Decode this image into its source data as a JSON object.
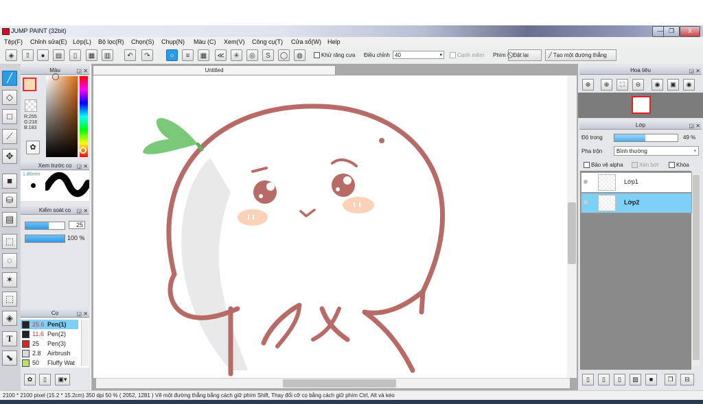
{
  "window": {
    "title": "JUMP PAINT (32bit)",
    "minimize": "—",
    "maximize": "❐",
    "close": "X"
  },
  "menu": [
    "Tệp(F)",
    "Chỉnh sửa(E)",
    "Lớp(L)",
    "Bộ lọc(R)",
    "Chọn(S)",
    "Chụp(N)",
    "Màu (C)",
    "Xem(V)",
    "Công cụ(T)",
    "Cửa sổ(W)",
    "Help"
  ],
  "toolbar": {
    "antialias_label": "Khử răng cưa",
    "adjust_label": "Điều chỉnh",
    "adjust_value": "40",
    "smooth_edge_label": "Cạnh mềm",
    "key_label": "Phím",
    "reset_label": "Đặt lại",
    "straight_line_label": "Tạo một đường thẳng"
  },
  "panels": {
    "color": {
      "title": "Màu",
      "r": "R:255",
      "g": "G:218",
      "b": "B:183",
      "fg_color": "#ffdab7"
    },
    "brush_preview": {
      "title": "Xem trước cọ",
      "size": "1.86mm"
    },
    "brush_control": {
      "title": "Kiểm soát cọ",
      "size_value": "25",
      "opacity_value": "100 %",
      "size_fraction": 0.6,
      "opacity_fraction": 1.0
    },
    "brushes": {
      "title": "Cọ",
      "items": [
        {
          "size": "25.6",
          "name": "Pen(1)",
          "color": "#222222",
          "selected": true
        },
        {
          "size": "11.6",
          "name": "Pen(2)",
          "color": "#222222",
          "selected": false
        },
        {
          "size": "25",
          "name": "Pen(3)",
          "color": "#dd2222",
          "selected": false
        },
        {
          "size": "2.8",
          "name": "Airbrush",
          "color": "#d8d8d8",
          "selected": false
        },
        {
          "size": "50",
          "name": "Fluffy Wat",
          "color": "#b9e06a",
          "selected": false
        }
      ]
    }
  },
  "document": {
    "tab_title": "Untitled"
  },
  "navigator": {
    "title": "Hoa tiêu"
  },
  "layers": {
    "title": "Lớp",
    "opacity_label": "Độ trong",
    "opacity_value": "49 %",
    "opacity_fraction": 0.49,
    "blend_label": "Pha trộn",
    "blend_value": "Bình thường",
    "protect_alpha_label": "Bảo vệ alpha",
    "draft_label": "Xén bớt",
    "lock_label": "Khóa",
    "items": [
      {
        "name": "Lớp1",
        "selected": false
      },
      {
        "name": "Lớp2",
        "selected": true
      }
    ]
  },
  "status": {
    "text": "2100 * 2100 pixel  (15.2 * 15.2cm)  350 dpi  50 %  ( 2052, 1281 )  Vẽ một đường thẳng bằng cách giữ phím Shift, Thay đổi cỡ cọ bằng cách giữ phím Ctrl, Alt và kéo"
  },
  "colors": {
    "accent": "#2c9be6",
    "stroke": "#b86a66",
    "leaf": "#7ac97a",
    "blush": "#fbd2b8"
  }
}
